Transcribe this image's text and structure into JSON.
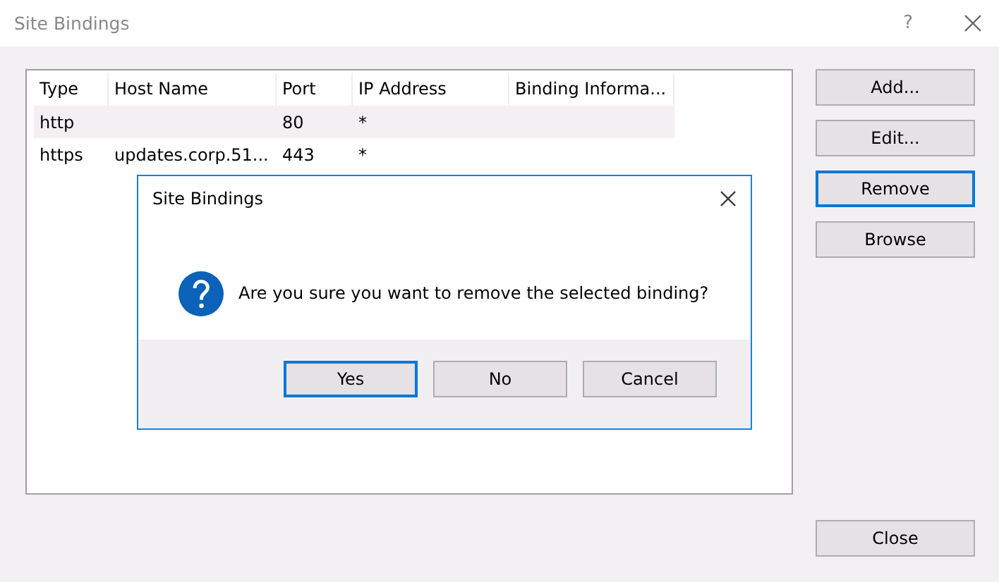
{
  "window": {
    "title": "Site Bindings",
    "help": "?"
  },
  "table": {
    "columns": [
      "Type",
      "Host Name",
      "Port",
      "IP Address",
      "Binding Informa..."
    ],
    "rows": [
      {
        "cells": [
          "http",
          "",
          "80",
          "*",
          ""
        ],
        "selected": true
      },
      {
        "cells": [
          "https",
          "updates.corp.51...",
          "443",
          "*",
          ""
        ],
        "selected": false
      }
    ]
  },
  "buttons": [
    {
      "label": "Add...",
      "focused": false
    },
    {
      "label": "Edit...",
      "focused": false
    },
    {
      "label": "Remove",
      "focused": true
    },
    {
      "label": "Browse",
      "focused": false
    }
  ],
  "close_button": "Close",
  "dialog": {
    "title": "Site Bindings",
    "message": "Are you sure you want to remove the selected binding?",
    "buttons": [
      {
        "label": "Yes",
        "focused": true
      },
      {
        "label": "No",
        "focused": false
      },
      {
        "label": "Cancel",
        "focused": false
      }
    ]
  }
}
